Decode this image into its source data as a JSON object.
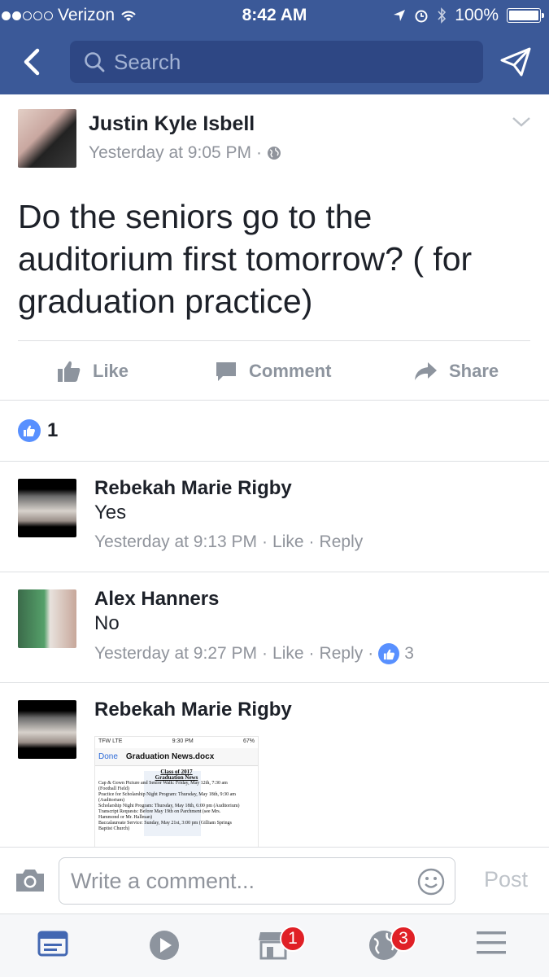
{
  "status_bar": {
    "carrier": "Verizon",
    "time": "8:42 AM",
    "battery": "100%"
  },
  "nav": {
    "search_placeholder": "Search"
  },
  "post": {
    "author": "Justin Kyle Isbell",
    "timestamp": "Yesterday at 9:05 PM",
    "separator": "·",
    "text": "Do the seniors go to the auditorium first tomorrow? ( for graduation practice)"
  },
  "actions": {
    "like": "Like",
    "comment": "Comment",
    "share": "Share"
  },
  "likes": {
    "count": "1"
  },
  "comments": [
    {
      "name": "Rebekah Marie Rigby",
      "text": "Yes",
      "timestamp": "Yesterday at 9:13 PM",
      "like_label": "Like",
      "reply_label": "Reply",
      "sep": "·"
    },
    {
      "name": "Alex Hanners",
      "text": "No",
      "timestamp": "Yesterday at 9:27 PM",
      "like_label": "Like",
      "reply_label": "Reply",
      "sep": "·",
      "reactions": "3"
    },
    {
      "name": "Rebekah Marie Rigby",
      "attachment": {
        "carrier": "TFW",
        "network": "LTE",
        "time": "9:30 PM",
        "battery": "67%",
        "done_label": "Done",
        "title": "Graduation News.docx",
        "doc_header_1": "Class of 2017",
        "doc_header_2": "Graduation News",
        "lines": [
          "Cap & Gown Picture and Senior Walk: Friday, May 12th, 7:30 am",
          "(Football Field)",
          "Practice for Scholarship Night Program: Thursday, May 18th, 9:30 am",
          "(Auditorium)",
          "Scholarship Night Program: Thursday, May 18th, 6:00 pm (Auditorium)",
          "Transcript Requests: Before May 19th on Parchment (see Mrs.",
          "Hammond or Mr. Hallman)",
          "Baccalaureate Service: Sunday, May 21st, 3:00 pm (Gilliam Springs",
          "Baptist Church)"
        ]
      }
    }
  ],
  "comment_bar": {
    "placeholder": "Write a comment...",
    "post_label": "Post"
  },
  "tab_bar": {
    "marketplace_badge": "1",
    "notifications_badge": "3"
  },
  "colors": {
    "brand": "#3b5998",
    "like_blue": "#5890ff",
    "badge_red": "#e02026",
    "meta_grey": "#90949c"
  }
}
